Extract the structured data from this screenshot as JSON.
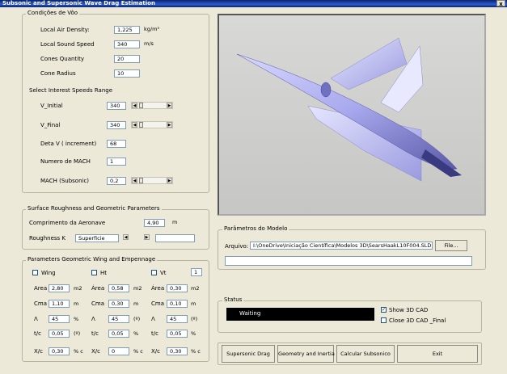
{
  "window": {
    "title": "Subsonic and Supersonic Wave Drag Estimation",
    "close": "x"
  },
  "flight": {
    "legend": "Condições de Vôo",
    "density_label": "Local Air Density:",
    "density_value": "1,225",
    "density_unit": "kg/m³",
    "sound_label": "Local Sound Speed",
    "sound_value": "340",
    "sound_unit": "m/s",
    "cones_label": "Cones Quantity",
    "cones_value": "20",
    "radius_label": "Cone Radius",
    "radius_value": "10",
    "range_heading": "Select Interest Speeds Range",
    "v_initial_label": "V_Initial",
    "v_initial_value": "340",
    "v_final_label": "V_Final",
    "v_final_value": "340",
    "delta_label": "Deta V ( increment)",
    "delta_value": "68",
    "mach_num_label": "Numero de MACH",
    "mach_num_value": "1",
    "mach_sub_label": "MACH (Subsonic)",
    "mach_sub_value": "0,2"
  },
  "surface": {
    "legend": "Surface Roughness and Geometric Parameters",
    "length_label": "Comprimento da Aeronave",
    "length_value": "4,90",
    "length_unit": "m",
    "roughness_label": "Roughness K",
    "roughness_value": "Superficie",
    "roughness_extra": ""
  },
  "wing": {
    "legend": "Parameters Geometric Wing and Empennage",
    "wing_label": "Wing",
    "ht_label": "Ht",
    "vt_label": "Vt",
    "count_value": "1",
    "cols": [
      {
        "area_label": "Area",
        "area": "2,80",
        "area_unit": "m2",
        "cma_label": "Cma",
        "cma": "1,10",
        "cma_unit": "m",
        "sweep_label": "Λ",
        "sweep": "45",
        "sweep_unit": "%",
        "tc_label": "t/c",
        "tc": "0,05",
        "tc_unit": "(º)",
        "xc_label": "X/c",
        "xc": "0,30",
        "xc_unit": "% c"
      },
      {
        "area_label": "Área",
        "area": "0,58",
        "area_unit": "m2",
        "cma_label": "Cma",
        "cma": "0,30",
        "cma_unit": "m",
        "sweep_label": "Λ",
        "sweep": "45",
        "sweep_unit": "(º)",
        "tc_label": "t/c",
        "tc": "0,05",
        "tc_unit": "%",
        "xc_label": "X/c",
        "xc": "0",
        "xc_unit": "% c"
      },
      {
        "area_label": "Área",
        "area": "0,30",
        "area_unit": "m2",
        "cma_label": "Cma",
        "cma": "0,10",
        "cma_unit": "m",
        "sweep_label": "Λ",
        "sweep": "45",
        "sweep_unit": "(º)",
        "tc_label": "t/c",
        "tc": "0,05",
        "tc_unit": "%",
        "xc_label": "X/c",
        "xc": "0,30",
        "xc_unit": "% c"
      }
    ]
  },
  "model": {
    "legend": "Parâmetros do Modelo",
    "file_label": "Arquivo:",
    "file_path": "I:\\OneDrive\\Iniciação Científica\\Modelos 3D\\SearsHaakL10F004.SLDPRT",
    "file_button": "File...",
    "extra_field": ""
  },
  "status": {
    "legend": "Status",
    "text": "Waiting",
    "show_cad_label": "Show 3D CAD",
    "show_cad_checked": "✓",
    "close_cad_label": "Close  3D CAD _Final"
  },
  "buttons": {
    "supersonic": "Supersonic Drag",
    "geometry": "Geometry and Inertia",
    "subsonic": "Calcular Subsonico",
    "exit": "Exit"
  },
  "colors": {
    "title_bar": "#0a246a",
    "form_bg": "#ece9d8",
    "status_bar": "#000000",
    "aircraft": "#b8b8f0"
  }
}
